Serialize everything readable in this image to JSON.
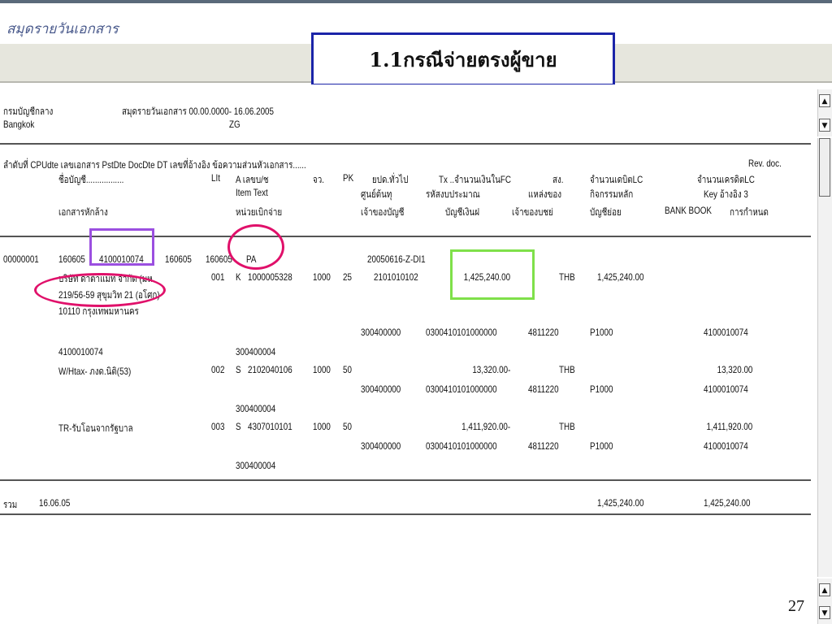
{
  "app": {
    "title": "สมุดรายวันเอกสาร"
  },
  "banner": {
    "text": "1.1กรณีจ่ายตรงผู้ขาย"
  },
  "report": {
    "company": "กรมบัญชีกลาง",
    "city": "Bangkok",
    "doc_title": "สมุดรายวันเอกสาร 00.00.0000- 16.06.2005",
    "code": "ZG"
  },
  "headers": {
    "row1": [
      "ลำดับที่ CPUdte เลขเอกสาร PstDte DocDte DT เลขที่อ้างอิง ข้อความส่วนหัวเอกสาร......",
      "Rev. doc."
    ],
    "row2": [
      "ชื่อบัญชี.................",
      "LIt",
      "A เลขบ/ช",
      "จว.",
      "PK",
      "ยปด.ทั่วไป",
      "Tx ..จำนวนเงินในFC",
      "สง.",
      "จำนวนเดบิตLC",
      "จำนวนเครดิตLC"
    ],
    "row3": [
      "Item Text",
      "ศูนย์ต้นทุ",
      "รหัสงบประมาณ",
      "แหล่งของ",
      "กิจกรรมหลัก",
      "Key อ้างอิง 3"
    ],
    "row4": [
      "เอกสารหักล้าง",
      "หน่วยเบิกจ่าย",
      "เจ้าของบัญชี",
      "บัญชีเงินฝ",
      "เจ้าของบชย่",
      "บัญชีย่อย",
      "BANK BOOK",
      "การกำหนด"
    ]
  },
  "doc": {
    "seq": "00000001",
    "cpudte": "160605",
    "docno": "4100010074",
    "pstdte": "160605",
    "docdte": "160605",
    "dt": "PA",
    "ref": "20050616-Z-DI1",
    "vendor_name": "บริษัท ดาต้าแมท จำกัด (มห",
    "vendor_addr": "219/56-59 สุขุมวิท 21 (อโศก)",
    "vendor_city": "10110 กรุงเทพมหานคร",
    "items": [
      {
        "lit": "001",
        "a": "K",
        "acct": "1000005328",
        "area": "1000",
        "pk": "25",
        "gl": "2101010102",
        "amount_fc": "1,425,240.00",
        "cur": "THB",
        "debit": "1,425,240.00",
        "credit": "",
        "cost": "300400000",
        "budget": "0300410101000000",
        "source": "4811220",
        "activity": "P1000",
        "key3": "4100010074",
        "clearing": "4100010074",
        "unit": "300400004"
      },
      {
        "name": "W/Htax- ภงด.นิติ(53)",
        "lit": "002",
        "a": "S",
        "acct": "2102040106",
        "area": "1000",
        "pk": "50",
        "amount_fc": "13,320.00-",
        "cur": "THB",
        "credit": "13,320.00",
        "cost": "300400000",
        "budget": "0300410101000000",
        "source": "4811220",
        "activity": "P1000",
        "key3": "4100010074",
        "unit": "300400004"
      },
      {
        "name": "TR-รับโอนจากรัฐบาล",
        "lit": "003",
        "a": "S",
        "acct": "4307010101",
        "area": "1000",
        "pk": "50",
        "amount_fc": "1,411,920.00-",
        "cur": "THB",
        "credit": "1,411,920.00",
        "cost": "300400000",
        "budget": "0300410101000000",
        "source": "4811220",
        "activity": "P1000",
        "key3": "4100010074",
        "unit": "300400004"
      }
    ]
  },
  "total": {
    "label": "รวม",
    "date": "16.06.05",
    "debit": "1,425,240.00",
    "credit": "1,425,240.00"
  },
  "scroll": {
    "up": "▲",
    "down": "▼"
  },
  "page_number": "27",
  "colors": {
    "banner_border": "#1b24a8",
    "purple_mark": "#9b4fe0",
    "pink_mark": "#e0106a",
    "green_mark": "#7fe04a"
  }
}
